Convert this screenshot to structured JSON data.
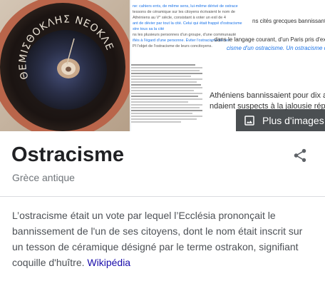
{
  "image_strip": {
    "more_images_label": "Plus d'images",
    "pottery_inscription": "ΘΕΜΙΣΘΟΚΛΗΣ ΝΕΟΚΛΕΟΣ",
    "document_snippets": {
      "top_lines": [
        "ne: cahiers erris, de même sens, lui-même dérivé de ostrace",
        "tessons de céramique sur les citoyens écrivaient le nom de",
        "Athéniens au V° siècle, consistant à voter un exil de 4",
        "ant de dévier par tout la cité. Celui qui était frappé d'ostracisme",
        "stre tous sa la cité",
        "ns les plusieurs personnes d'un groupe, d'une communauté",
        "ifiés à l'égard d'une personne. Éviter l'ostracisme de son",
        "Pl l'objet de l'ostracisme de leurs concitoyens."
      ],
      "side_lines": [
        "ns cités grecques bannissant pour dix ans le",
        ", dans le langage courant, d'un Paris pris d'exclusion",
        "cisme d'un ostracisme. Un ostracisme que rien ne"
      ],
      "large_lines": [
        "Athéniens bannissaient pour dix ans",
        "ndaient suspects à la jalousie républic"
      ]
    }
  },
  "title_section": {
    "title": "Ostracisme",
    "subtitle": "Grèce antique"
  },
  "description": {
    "text": "L’ostracisme était un vote par lequel l’Ecclésia prononçait le bannissement de l'un de ses citoyens, dont le nom était inscrit sur un tesson de céramique désigné par le terme ostrakon, signifiant coquille d'huître.",
    "source_label": "Wikipédia"
  },
  "colors": {
    "link": "#1a0dab",
    "text": "#4d5156",
    "title": "#202124",
    "subtitle": "#70757a",
    "overlay": "#3c4043"
  },
  "icons": {
    "share": "share-icon",
    "images": "image-icon"
  }
}
